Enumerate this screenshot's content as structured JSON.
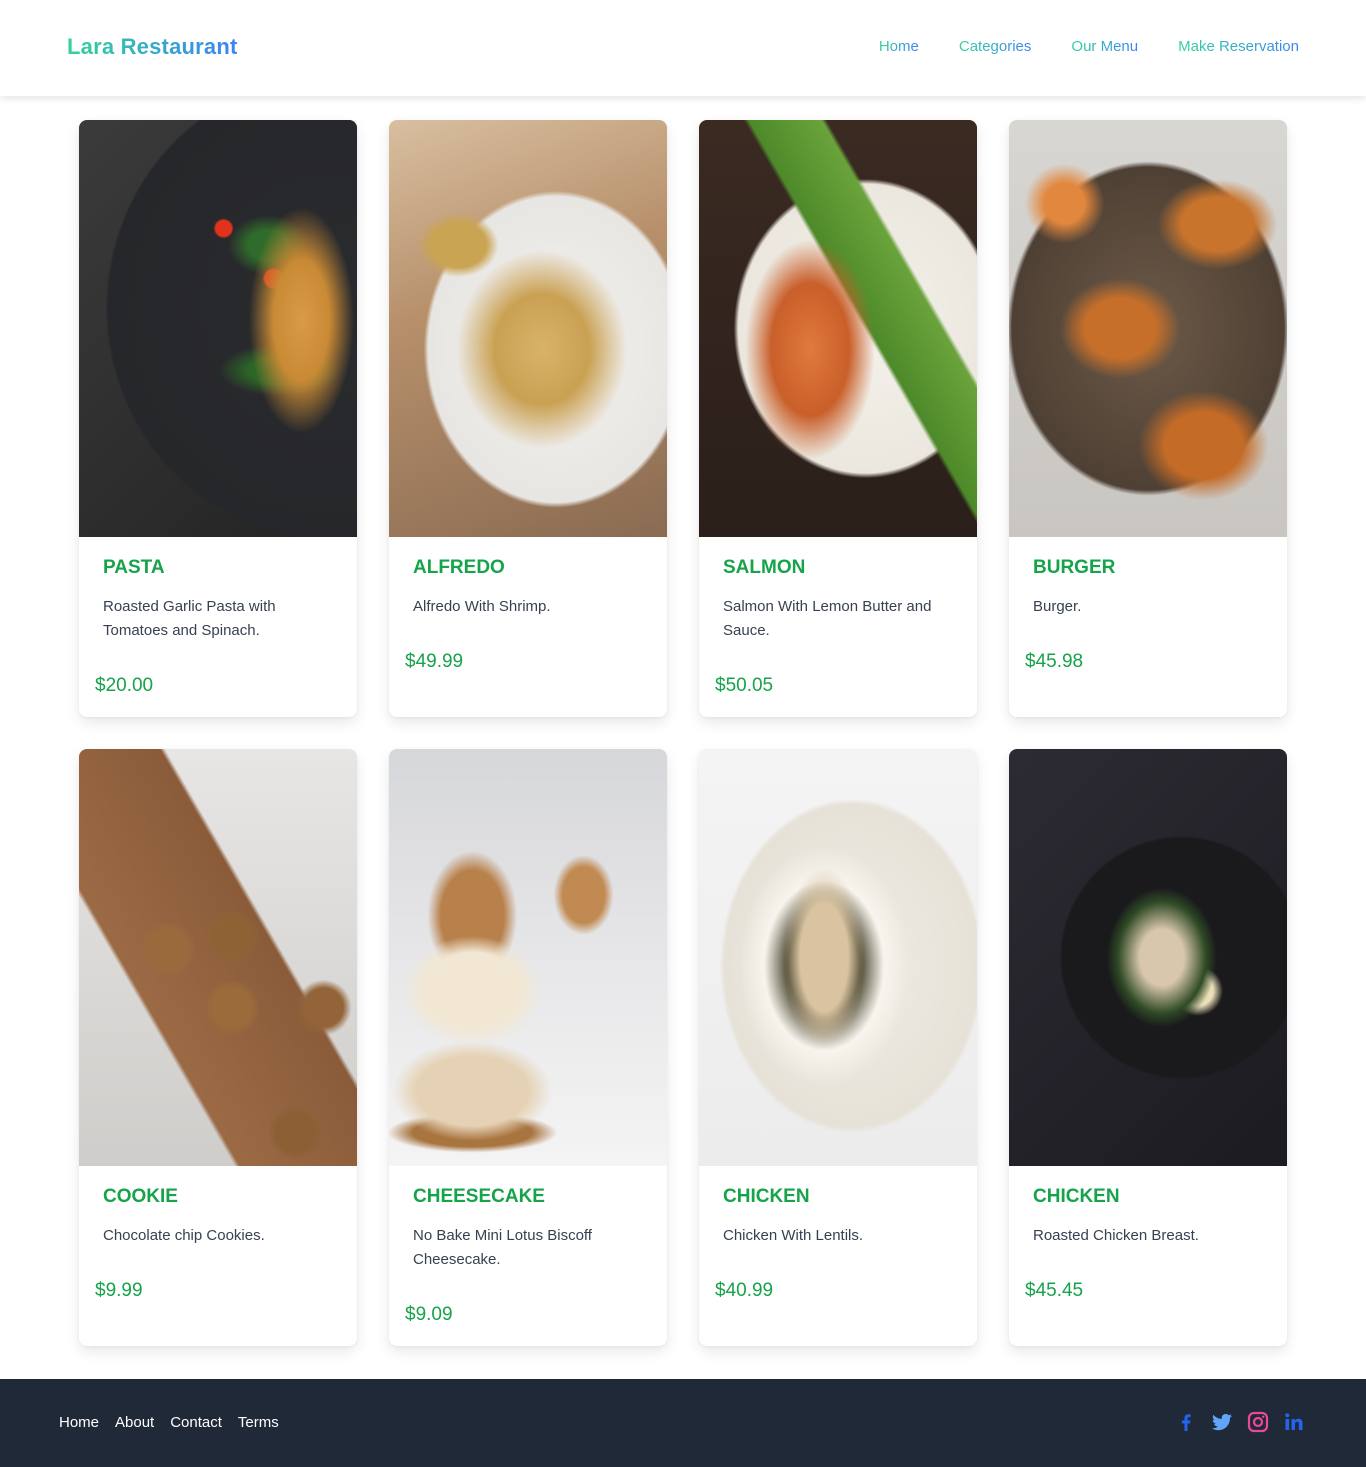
{
  "header": {
    "logo": "Lara Restaurant",
    "nav": [
      {
        "label": "Home"
      },
      {
        "label": "Categories"
      },
      {
        "label": "Our Menu"
      },
      {
        "label": "Make Reservation"
      }
    ],
    "gradient_colors": [
      "#34d399",
      "#3b82f6"
    ]
  },
  "menu": {
    "items": [
      {
        "title": "PASTA",
        "description": "Roasted Garlic Pasta with Tomatoes and Spinach.",
        "price": "$20.00",
        "image": "pasta-photo"
      },
      {
        "title": "ALFREDO",
        "description": "Alfredo With Shrimp.",
        "price": "$49.99",
        "image": "alfredo-photo"
      },
      {
        "title": "SALMON",
        "description": "Salmon With Lemon Butter and Sauce.",
        "price": "$50.05",
        "image": "salmon-photo"
      },
      {
        "title": "BURGER",
        "description": "Burger.",
        "price": "$45.98",
        "image": "burger-photo"
      },
      {
        "title": "COOKIE",
        "description": "Chocolate chip Cookies.",
        "price": "$9.99",
        "image": "cookie-photo"
      },
      {
        "title": "CHEESECAKE",
        "description": "No Bake Mini Lotus Biscoff Cheesecake.",
        "price": "$9.09",
        "image": "cheesecake-photo"
      },
      {
        "title": "CHICKEN",
        "description": "Chicken With Lentils.",
        "price": "$40.99",
        "image": "chicken-lentils-photo"
      },
      {
        "title": "CHICKEN",
        "description": "Roasted Chicken Breast.",
        "price": "$45.45",
        "image": "roasted-chicken-photo"
      }
    ],
    "accent_color": "#16a34a"
  },
  "footer": {
    "links": [
      {
        "label": "Home"
      },
      {
        "label": "About"
      },
      {
        "label": "Contact"
      },
      {
        "label": "Terms"
      }
    ],
    "social": [
      {
        "icon": "facebook-icon",
        "color": "#2563eb"
      },
      {
        "icon": "twitter-icon",
        "color": "#60a5fa"
      },
      {
        "icon": "instagram-icon",
        "color": "#ec4899"
      },
      {
        "icon": "linkedin-icon",
        "color": "#2563eb"
      }
    ],
    "background": "#1f2937"
  }
}
